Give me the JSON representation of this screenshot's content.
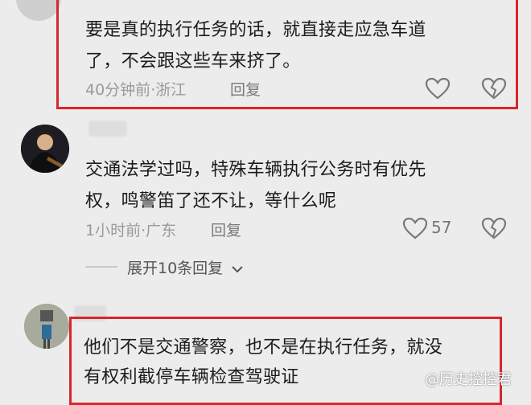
{
  "comments": [
    {
      "text_line1": "要是真的执行任务的话，就直接走应急车道",
      "text_line2": "了，不会跟这些车来挤了。",
      "time": "40分钟前",
      "sep": "·",
      "location": "浙江",
      "reply_label": "回复"
    },
    {
      "text_line1": "交通法学过吗，特殊车辆执行公务时有优先",
      "text_line2": "权，鸣警笛了还不让，等什么呢",
      "time": "1小时前",
      "sep": "·",
      "location": "广东",
      "reply_label": "回复",
      "like_count": "57"
    },
    {
      "text_line1": "他们不是交通警察，也不是在执行任务，就没",
      "text_line2": "有权利截停车辆检查驾驶证"
    }
  ],
  "expand_label": "展开10条回复",
  "watermark": "@历史控控君",
  "colors": {
    "highlight": "#d8262b",
    "background": "#ececec"
  }
}
